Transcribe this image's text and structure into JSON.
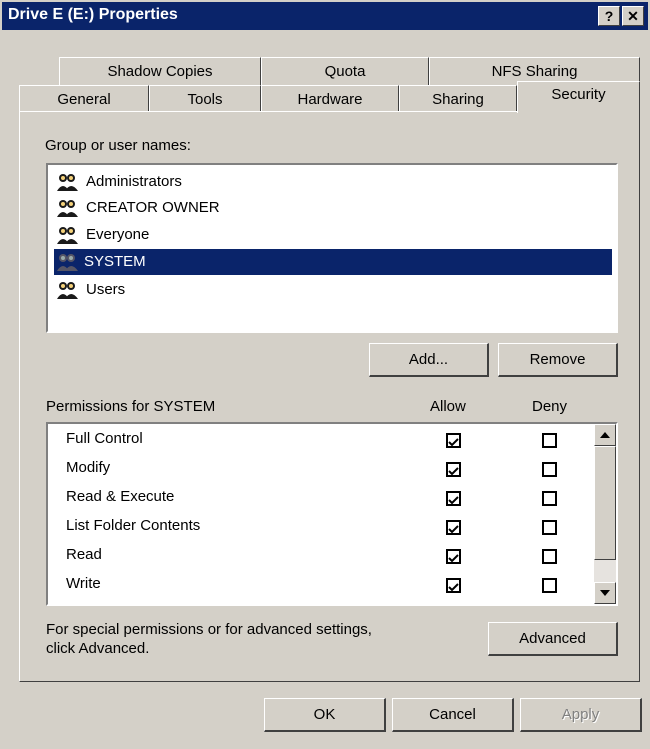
{
  "window": {
    "title": "Drive E (E:) Properties",
    "help_glyph": "?",
    "close_glyph": "✕"
  },
  "tabs": {
    "row1": [
      {
        "label": "Shadow Copies"
      },
      {
        "label": "Quota"
      },
      {
        "label": "NFS Sharing"
      }
    ],
    "row2": [
      {
        "label": "General"
      },
      {
        "label": "Tools"
      },
      {
        "label": "Hardware"
      },
      {
        "label": "Sharing"
      },
      {
        "label": "Security",
        "active": true
      }
    ]
  },
  "security": {
    "group_label": "Group or user names:",
    "users": [
      {
        "name": "Administrators",
        "icon": "users-group-icon"
      },
      {
        "name": "CREATOR OWNER",
        "icon": "users-group-icon"
      },
      {
        "name": "Everyone",
        "icon": "users-group-icon"
      },
      {
        "name": "SYSTEM",
        "icon": "users-group-icon",
        "selected": true
      },
      {
        "name": "Users",
        "icon": "users-group-icon"
      }
    ],
    "add_label": "Add...",
    "remove_label": "Remove",
    "permissions_label": "Permissions for SYSTEM",
    "allow_header": "Allow",
    "deny_header": "Deny",
    "permissions": [
      {
        "name": "Full Control",
        "allow": true,
        "deny": false
      },
      {
        "name": "Modify",
        "allow": true,
        "deny": false
      },
      {
        "name": "Read & Execute",
        "allow": true,
        "deny": false
      },
      {
        "name": "List Folder Contents",
        "allow": true,
        "deny": false
      },
      {
        "name": "Read",
        "allow": true,
        "deny": false
      },
      {
        "name": "Write",
        "allow": true,
        "deny": false
      }
    ],
    "advanced_note_line1": "For special permissions or for advanced settings,",
    "advanced_note_line2": "click Advanced.",
    "advanced_label": "Advanced"
  },
  "footer": {
    "ok_label": "OK",
    "cancel_label": "Cancel",
    "apply_label": "Apply"
  }
}
